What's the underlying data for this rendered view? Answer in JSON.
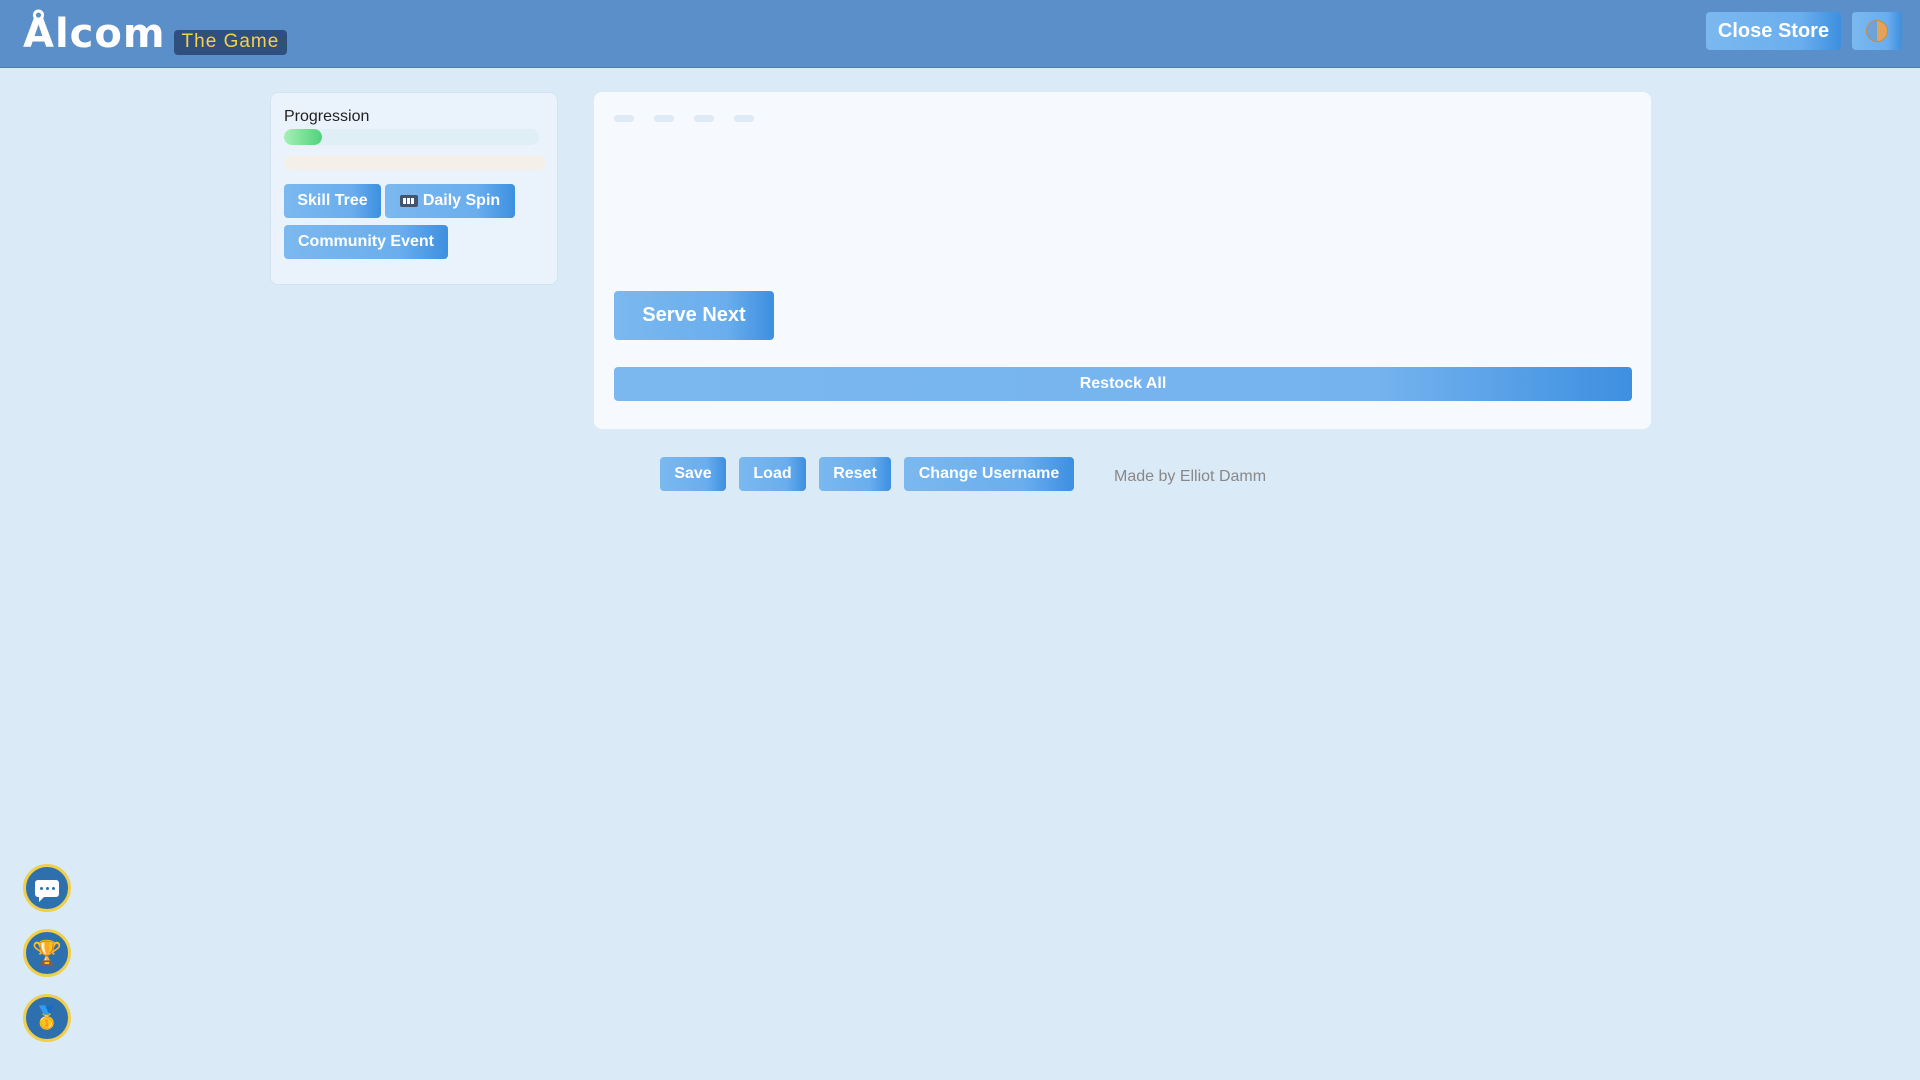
{
  "header": {
    "title": "Ålcom",
    "tag": "The Game",
    "close_store_label": "Close Store",
    "theme_icon": "theme-toggle-icon"
  },
  "sidebar": {
    "progression_label": "Progression",
    "progression_fraction": 0.15,
    "buttons": {
      "skill_tree": "Skill Tree",
      "daily_spin": "Daily Spin",
      "community_event": "Community Event"
    }
  },
  "main": {
    "serve_next_label": "Serve Next",
    "restock_all_label": "Restock All"
  },
  "footer": {
    "save_label": "Save",
    "load_label": "Load",
    "reset_label": "Reset",
    "change_username_label": "Change Username",
    "credit": "Made by Elliot Damm"
  },
  "floating": {
    "chat_icon": "chat-icon",
    "trophy_icon": "trophy-icon",
    "medal_icon": "medal-icon"
  },
  "colors": {
    "header_bg": "#5b8fc9",
    "page_bg": "#dbeaf7",
    "accent": "#6aaeee",
    "tag_bg": "#2f4f7f",
    "tag_text": "#f2d24b",
    "float_ring": "#f0cf4a"
  }
}
